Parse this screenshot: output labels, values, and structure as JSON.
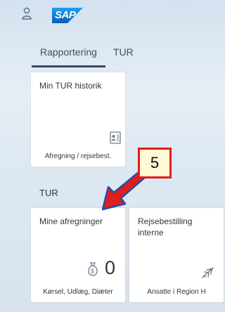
{
  "header": {
    "logo_text": "SAP",
    "logo_color": "#1c7fd1"
  },
  "tabs": [
    {
      "label": "Rapportering",
      "selected": true
    },
    {
      "label": "TUR",
      "selected": false
    }
  ],
  "tiles_top": [
    {
      "title": "Min TUR historik",
      "footer": "Afregning / rejsebest.",
      "icon": "expense-report-icon"
    }
  ],
  "section": {
    "title": "TUR"
  },
  "tiles_section": [
    {
      "title": "Mine afregninger",
      "footer": "Kørsel, Udlæg, Diæter",
      "icon": "money-bag-icon",
      "kpi": "0"
    },
    {
      "title": "Rejsebestilling interne",
      "footer": "Ansatte i Region H",
      "icon": "airplane-icon"
    }
  ],
  "annotation": {
    "number": "5",
    "border_color": "#e21d1d",
    "arrow_color": "#e21d1d",
    "arrow_outline": "#1f4fa8"
  }
}
